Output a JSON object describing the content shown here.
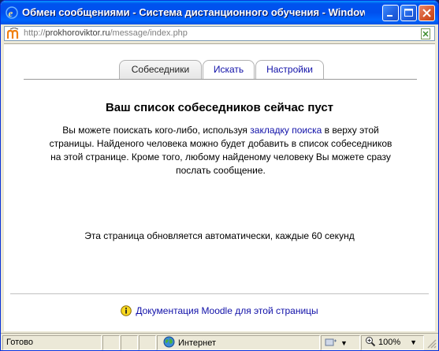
{
  "window": {
    "title": "Обмен сообщениями - Система дистанционного обучения - Windows...",
    "minimize_label": "_",
    "maximize_label": "□",
    "close_label": "×"
  },
  "address": {
    "prefix": "http://",
    "host": "prokhorovikt​or.ru",
    "path": "/message/index.php"
  },
  "tabs": [
    {
      "label": "Собеседники",
      "active": true
    },
    {
      "label": "Искать",
      "active": false
    },
    {
      "label": "Настройки",
      "active": false
    }
  ],
  "main": {
    "heading": "Ваш список собеседников сейчас пуст",
    "desc_before": "Вы можете поискать кого-либо, используя ",
    "desc_link": "закладку поиска",
    "desc_after": " в верху этой страницы. Найденого человека можно будет добавить в список собеседников на этой странице. Кроме того, любому найденому человеку Вы можете сразу послать сообщение.",
    "refresh_note": "Эта страница обновляется автоматически, каждые 60 секунд",
    "doc_link": "Документация Moodle для этой страницы"
  },
  "status": {
    "ready": "Готово",
    "zone": "Интернет",
    "zoom": "100%"
  }
}
